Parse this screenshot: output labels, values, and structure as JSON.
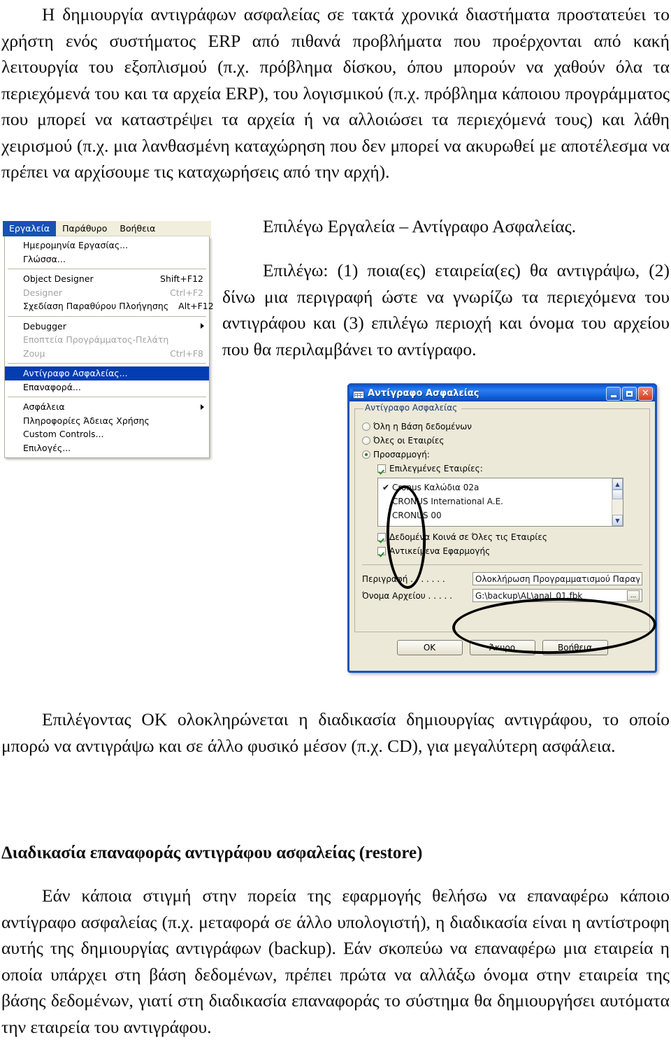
{
  "document": {
    "para_intro": "Η δημιουργία αντιγράφων ασφαλείας σε τακτά χρονικά διαστήματα προστατεύει το χρήστη ενός συστήματος ERP από πιθανά προβλήματα που προέρχονται από κακή λειτουργία του εξοπλισμού (π.χ. πρόβλημα δίσκου, όπου μπορούν να χαθούν όλα τα περιεχόμενά του και τα αρχεία ERP), του λογισμικού (π.χ. πρόβλημα κάποιου προγράμματος που μπορεί να καταστρέψει τα αρχεία ή να αλλοιώσει τα περιεχόμενά τους) και λάθη χειρισμού (π.χ. μια λανθασμένη καταχώρηση που δεν μπορεί να ακυρωθεί με αποτέλεσμα να πρέπει να αρχίσουμε τις καταχωρήσεις από την αρχή).",
    "para_select_menu": "Επιλέγω Εργαλεία – Αντίγραφο Ασφαλείας.",
    "para_select_steps": "Επιλέγω: (1) ποια(ες) εταιρεία(ες) θα αντιγράψω, (2) δίνω μια περιγραφή ώστε να γνωρίζω τα περιεχόμενα του αντιγράφου και (3) επιλέγω περιοχή και όνομα του αρχείου που θα περιλαμβάνει το αντίγραφο.",
    "para_ok": "Επιλέγοντας ΟΚ ολοκληρώνεται η διαδικασία δημιουργίας αντιγράφου, το οποίο μπορώ να αντιγράψω και σε άλλο φυσικό μέσον (π.χ. CD), για μεγαλύτερη ασφάλεια.",
    "heading_restore": "Διαδικασία επαναφοράς αντιγράφου ασφαλείας (restore)",
    "para_restore": "Εάν κάποια στιγμή στην πορεία της εφαρμογής θελήσω να επαναφέρω κάποιο αντίγραφο ασφαλείας (π.χ. μεταφορά σε άλλο υπολογιστή), η διαδικασία είναι η αντίστροφη αυτής της δημιουργίας αντιγράφων (backup). Εάν σκοπεύω να επαναφέρω μια εταιρεία η οποία υπάρχει στη βάση δεδομένων, πρέπει πρώτα να αλλάξω όνομα στην εταιρεία της βάσης δεδομένων, γιατί στη διαδικασία επαναφοράς το σύστημα θα δημιουργήσει αυτόματα την εταιρεία του αντιγράφου."
  },
  "menu_screenshot": {
    "menubar": [
      {
        "label": "Εργαλεία",
        "active": true
      },
      {
        "label": "Παράθυρο",
        "active": false
      },
      {
        "label": "Βοήθεια",
        "active": false
      }
    ],
    "items": [
      {
        "label": "Ημερομηνία Εργασίας...",
        "accel": "",
        "disabled": false,
        "selected": false,
        "submenu": false
      },
      {
        "label": "Γλώσσα...",
        "accel": "",
        "disabled": false,
        "selected": false,
        "submenu": false
      },
      {
        "separator": true
      },
      {
        "label": "Object Designer",
        "accel": "Shift+F12",
        "disabled": false,
        "selected": false,
        "submenu": false
      },
      {
        "label": "Designer",
        "accel": "Ctrl+F2",
        "disabled": true,
        "selected": false,
        "submenu": false
      },
      {
        "label": "Σχεδίαση Παραθύρου Πλοήγησης",
        "accel": "Alt+F12",
        "disabled": false,
        "selected": false,
        "submenu": false
      },
      {
        "separator": true
      },
      {
        "label": "Debugger",
        "accel": "",
        "disabled": false,
        "selected": false,
        "submenu": true
      },
      {
        "label": "Εποπτεία Προγράμματος-Πελάτη",
        "accel": "",
        "disabled": true,
        "selected": false,
        "submenu": false
      },
      {
        "label": "Ζουμ",
        "accel": "Ctrl+F8",
        "disabled": true,
        "selected": false,
        "submenu": false
      },
      {
        "separator": true
      },
      {
        "label": "Αντίγραφο Ασφαλείας...",
        "accel": "",
        "disabled": false,
        "selected": true,
        "submenu": false
      },
      {
        "label": "Επαναφορά...",
        "accel": "",
        "disabled": false,
        "selected": false,
        "submenu": false
      },
      {
        "separator": true
      },
      {
        "label": "Ασφάλεια",
        "accel": "",
        "disabled": false,
        "selected": false,
        "submenu": true
      },
      {
        "label": "Πληροφορίες Άδειας Χρήσης",
        "accel": "",
        "disabled": false,
        "selected": false,
        "submenu": false
      },
      {
        "label": "Custom Controls...",
        "accel": "",
        "disabled": false,
        "selected": false,
        "submenu": false
      },
      {
        "label": "Επιλογές...",
        "accel": "",
        "disabled": false,
        "selected": false,
        "submenu": false
      }
    ]
  },
  "dialog": {
    "title": "Αντίγραφο Ασφαλείας",
    "titlebar_buttons": {
      "minimize": "_",
      "maximize": "□",
      "close": "✕"
    },
    "groupbox_title": "Αντίγραφο Ασφαλείας",
    "radios": [
      {
        "label": "Όλη η Βάση δεδομένων",
        "checked": false
      },
      {
        "label": "Όλες οι Εταιρίες",
        "checked": false
      },
      {
        "label": "Προσαρμογή:",
        "checked": true
      }
    ],
    "checkbox_selected_companies": {
      "label": "Επιλεγμένες Εταιρίες:",
      "checked": true
    },
    "company_list": [
      {
        "name": "Cronus Καλώδια 02a",
        "checked": true
      },
      {
        "name": "CRONUS International A.E.",
        "checked": false
      },
      {
        "name": "CRONUS 00",
        "checked": false
      }
    ],
    "checkbox_common_data": {
      "label": "Δεδομένα Κοινά σε Όλες τις Εταιρίες",
      "checked": true
    },
    "checkbox_app_objects": {
      "label": "Αντικείμενα Εφαρμογής",
      "checked": true
    },
    "fields": [
      {
        "label": "Περιγραφή . . . . . . .",
        "value": "Ολοκλήρωση Προγραμματισμού Παραγωγι",
        "has_browse": false
      },
      {
        "label": "Όνομα Αρχείου . . . . .",
        "value": "G:\\backup\\AL\\anal_01.fbk",
        "has_browse": true,
        "browse_label": "..."
      }
    ],
    "buttons": [
      {
        "label": "OK"
      },
      {
        "label": "Άκυρο"
      },
      {
        "label": "Βοήθεια"
      }
    ]
  },
  "colors": {
    "titlebar_blue": "#1064e2",
    "menu_highlight": "#0a40b0",
    "dialog_face": "#ece9d8",
    "groupbox_title": "#1a3a6a",
    "check_green": "#2e8b2e"
  }
}
